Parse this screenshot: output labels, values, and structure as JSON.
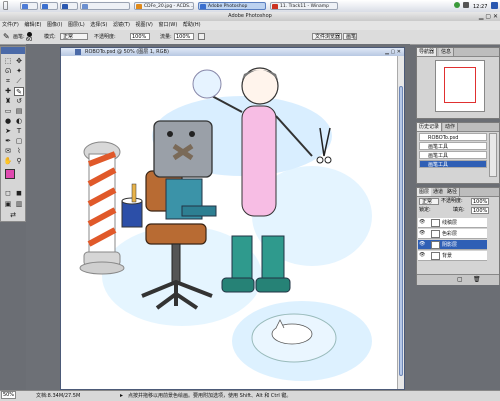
{
  "taskbar": {
    "tasks": [
      {
        "label": "",
        "color": "#4d7bd6"
      },
      {
        "label": "",
        "color": "#3a6fcf"
      },
      {
        "label": "",
        "color": "#2a58b0"
      },
      {
        "label": "",
        "color": "#6a8fd0"
      },
      {
        "label": "CDFe_20.jpg - ACDS...",
        "color": "#e08a1a"
      },
      {
        "label": "Adobe Photoshop",
        "color": "#3a6fcf"
      },
      {
        "label": "11. Track11 - Winamp",
        "color": "#cc3322"
      }
    ],
    "clock": "12:27"
  },
  "app": {
    "title": "Adobe Photoshop"
  },
  "menu": [
    "文件(F)",
    "编辑(E)",
    "图像(I)",
    "图层(L)",
    "选择(S)",
    "滤镜(T)",
    "视图(V)",
    "窗口(W)",
    "帮助(H)"
  ],
  "options": {
    "brush_label": "画笔:",
    "brush_size": "60",
    "mode_label": "模式:",
    "mode_value": "正常",
    "opacity_label": "不透明度:",
    "opacity_value": "100%",
    "flow_label": "流量:",
    "flow_value": "100%",
    "browser_tab": "文件浏览器",
    "brushes_tab": "画笔"
  },
  "document": {
    "title": "ROBOTo.psd @ 50% (图层 1, RGB)"
  },
  "navigator": {
    "tabs": [
      "导航器",
      "信息"
    ]
  },
  "history": {
    "tabs": [
      "历史记录",
      "动作"
    ],
    "items": [
      "ROBOTo.psd",
      "画笔工具",
      "画笔工具",
      "画笔工具"
    ]
  },
  "layers": {
    "tabs": [
      "图层",
      "通道",
      "路径"
    ],
    "mode": "正常",
    "opacity_label": "不透明度:",
    "opacity": "100%",
    "lock_label": "锁定:",
    "fill_label": "填充:",
    "fill": "100%",
    "rows": [
      {
        "name": "线稿层",
        "selected": false
      },
      {
        "name": "色彩层",
        "selected": false
      },
      {
        "name": "阴影层",
        "selected": true
      },
      {
        "name": "背景",
        "selected": false
      }
    ]
  },
  "status": {
    "zoom": "50%",
    "doc": "文档:8.34M/27.5M",
    "hint": "点按并拖移以用前景色绘画。要用附加选项，使用 Shift、Alt 和 Ctrl 键。"
  },
  "colors": {
    "foreground": "#e04ab0",
    "background": "#bfe9ff",
    "accent": "#2f5fb5"
  }
}
